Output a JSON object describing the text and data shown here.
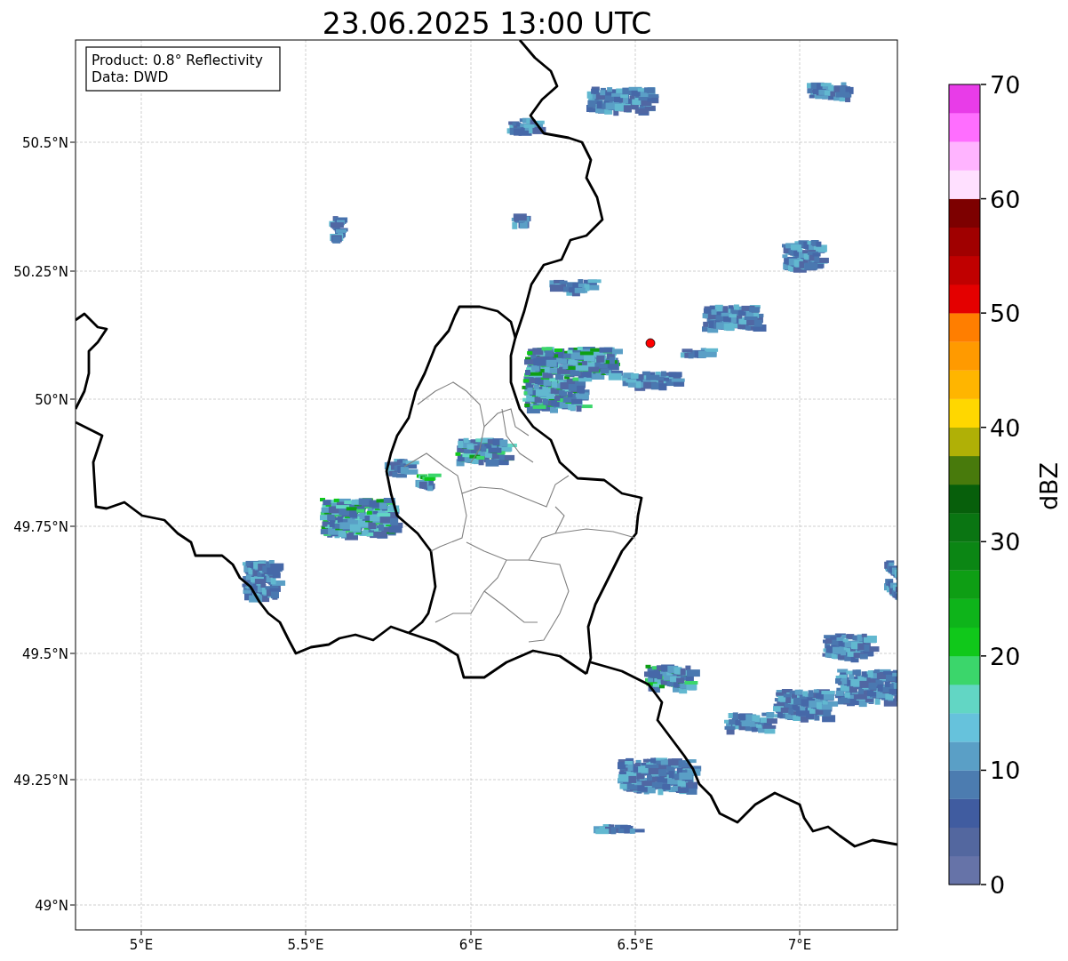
{
  "title": "23.06.2025 13:00 UTC",
  "info_box": [
    "Product: 0.8° Reflectivity",
    "Data: DWD"
  ],
  "map": {
    "lat_ticks": [
      "50.5°N",
      "50.25°N",
      "50°N",
      "49.75°N",
      "49.5°N",
      "49.25°N",
      "49°N"
    ],
    "lon_ticks": [
      "5°E",
      "5.5°E",
      "6°E",
      "6.5°E",
      "7°E"
    ]
  },
  "colorbar": {
    "label": "dBZ",
    "ticks": [
      "70",
      "60",
      "50",
      "40",
      "30",
      "20",
      "10",
      "0"
    ],
    "levels": [
      {
        "color": "#6673a8"
      },
      {
        "color": "#53679f"
      },
      {
        "color": "#405ca0"
      },
      {
        "color": "#4c7cb0"
      },
      {
        "color": "#5a9fc6"
      },
      {
        "color": "#66c2dc"
      },
      {
        "color": "#62d6c4"
      },
      {
        "color": "#3bd66b"
      },
      {
        "color": "#10c81a"
      },
      {
        "color": "#0eb41a"
      },
      {
        "color": "#0e9e14"
      },
      {
        "color": "#0b8614"
      },
      {
        "color": "#0a7512"
      },
      {
        "color": "#075f0b"
      },
      {
        "color": "#487a0c"
      },
      {
        "color": "#b0b006"
      },
      {
        "color": "#ffd700"
      },
      {
        "color": "#ffb500"
      },
      {
        "color": "#ff9a00"
      },
      {
        "color": "#ff7e00"
      },
      {
        "color": "#e40000"
      },
      {
        "color": "#c00000"
      },
      {
        "color": "#a00000"
      },
      {
        "color": "#7d0000"
      },
      {
        "color": "#ffe0ff"
      },
      {
        "color": "#ffb4ff"
      },
      {
        "color": "#ff6eff"
      },
      {
        "color": "#e83ce8"
      }
    ]
  }
}
